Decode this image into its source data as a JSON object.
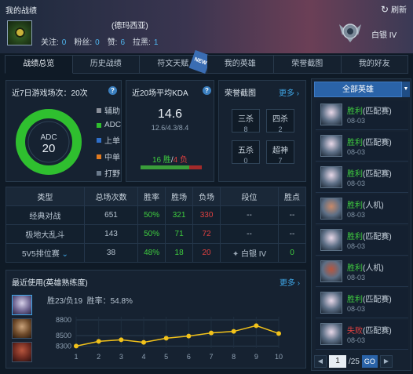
{
  "header": {
    "title": "我的战绩",
    "server": "(德玛西亚)",
    "stats": [
      {
        "label": "关注:",
        "value": "0"
      },
      {
        "label": "粉丝:",
        "value": "0"
      },
      {
        "label": "赞:",
        "value": "6"
      },
      {
        "label": "拉黑:",
        "value": "1"
      }
    ],
    "refresh_label": "刷新",
    "rank": "白银 IV"
  },
  "tabs": [
    {
      "label": "战绩总览"
    },
    {
      "label": "历史战绩"
    },
    {
      "label": "符文天赋",
      "badge": "NEW"
    },
    {
      "label": "我的英雄"
    },
    {
      "label": "荣誉截图"
    },
    {
      "label": "我的好友"
    }
  ],
  "roles_panel": {
    "title": "近7日游戏场次：20次",
    "center_role": "ADC",
    "center_count": "20",
    "legend": [
      {
        "label": "辅助",
        "color": "#8a8f99"
      },
      {
        "label": "ADC",
        "color": "#2fbf2f"
      },
      {
        "label": "上单",
        "color": "#2f6fc9"
      },
      {
        "label": "中单",
        "color": "#e07a20"
      },
      {
        "label": "打野",
        "color": "#6a7a8c"
      }
    ],
    "adc_fraction": 1.0
  },
  "kda_panel": {
    "title": "近20场平均KDA",
    "kda": "14.6",
    "kda_detail": "12.6/4.3/8.4",
    "wins": "16 胜",
    "sep": "/",
    "losses": "4 负",
    "win_fraction": 0.8
  },
  "honor_panel": {
    "title": "荣誉截图",
    "more": "更多",
    "items": [
      {
        "label": "三杀",
        "value": "8"
      },
      {
        "label": "四杀",
        "value": "2"
      },
      {
        "label": "五杀",
        "value": "0"
      },
      {
        "label": "超神",
        "value": "7"
      }
    ]
  },
  "table": {
    "headers": [
      "类型",
      "总场次数",
      "胜率",
      "胜场",
      "负场",
      "段位",
      "胜点"
    ],
    "rows": [
      [
        "经典对战",
        "651",
        "50%",
        "321",
        "330",
        "--",
        "--"
      ],
      [
        "极地大乱斗",
        "143",
        "50%",
        "71",
        "72",
        "--",
        "--"
      ],
      [
        "5V5排位赛",
        "38",
        "48%",
        "18",
        "20",
        "白银 IV",
        "0"
      ]
    ]
  },
  "recent": {
    "title": "最近使用(英雄熟练度)",
    "more": "更多",
    "summary_record": "胜23/负19",
    "summary_rate": "胜率：54.8%"
  },
  "chart_data": {
    "type": "line",
    "x": [
      1,
      2,
      3,
      4,
      5,
      6,
      7,
      8,
      9,
      10
    ],
    "series": [
      {
        "values": [
          8300,
          8390,
          8420,
          8370,
          8450,
          8490,
          8550,
          8580,
          8690,
          8540
        ]
      }
    ],
    "yticks": [
      "8800",
      "8500",
      "8300"
    ],
    "ylim": [
      8260,
      8860
    ]
  },
  "matches": [
    {
      "result": "胜利",
      "mode": "(匹配赛)",
      "date": "08-03",
      "win": true
    },
    {
      "result": "胜利",
      "mode": "(匹配赛)",
      "date": "08-03",
      "win": true
    },
    {
      "result": "胜利",
      "mode": "(匹配赛)",
      "date": "08-03",
      "win": true
    },
    {
      "result": "胜利",
      "mode": "(人机)",
      "date": "08-03",
      "win": true
    },
    {
      "result": "胜利",
      "mode": "(匹配赛)",
      "date": "08-03",
      "win": true
    },
    {
      "result": "胜利",
      "mode": "(人机)",
      "date": "08-03",
      "win": true
    },
    {
      "result": "胜利",
      "mode": "(匹配赛)",
      "date": "08-03",
      "win": true
    },
    {
      "result": "失败",
      "mode": "(匹配赛)",
      "date": "08-03",
      "win": false
    }
  ],
  "filter": {
    "label": "全部英雄"
  },
  "pager": {
    "current": "1",
    "total": "/25",
    "go": "GO"
  }
}
